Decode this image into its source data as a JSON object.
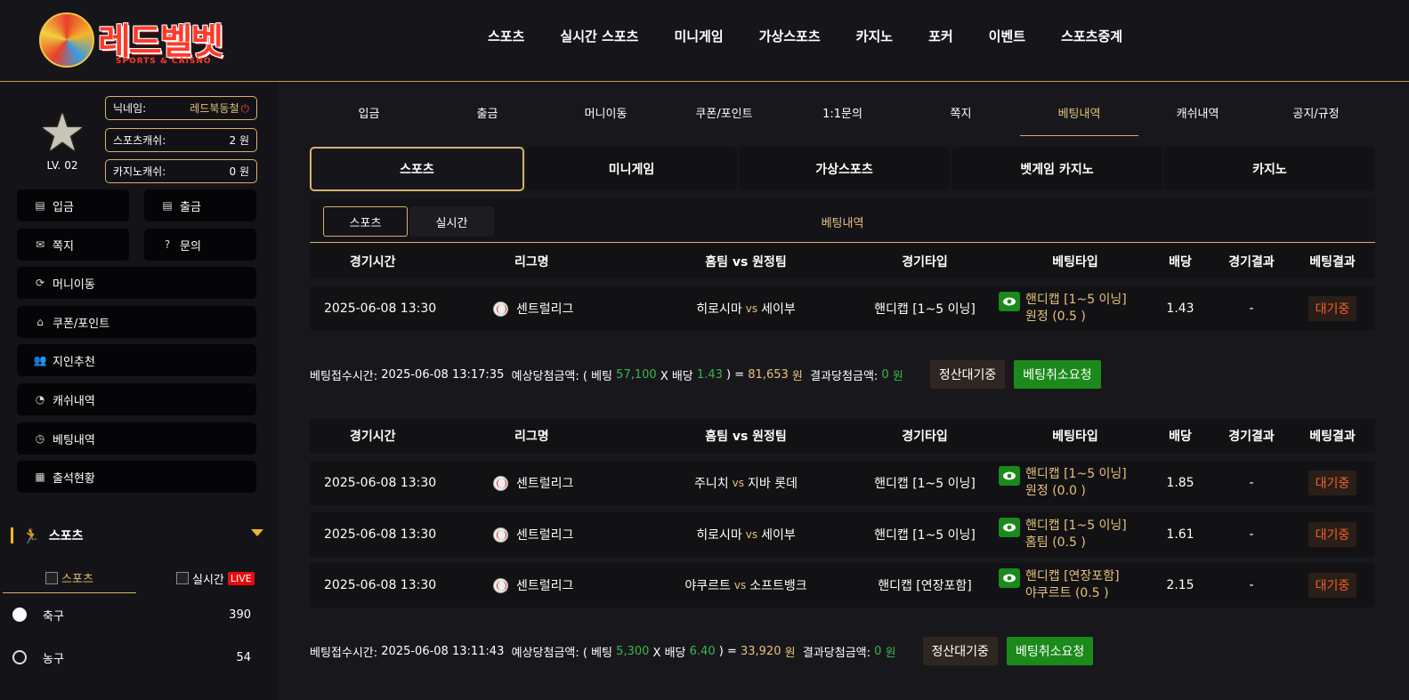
{
  "header": {
    "logo_text": "레드벨벳",
    "logo_sub": "SPORTS & CAISNO",
    "nav": [
      "스포츠",
      "실시간 스포츠",
      "미니게임",
      "가상스포츠",
      "카지노",
      "포커",
      "이벤트",
      "스포츠중계"
    ]
  },
  "profile": {
    "level": "LV. 02",
    "nickname_label": "닉네임:",
    "nickname": "레드북동철",
    "sports_cash_label": "스포츠캐쉬:",
    "sports_cash": "2 원",
    "casino_cash_label": "카지노캐쉬:",
    "casino_cash": "0 원"
  },
  "sidebar": {
    "buttons": [
      "입금",
      "출금",
      "쪽지",
      "문의",
      "머니이동",
      "쿠폰/포인트",
      "지인추천",
      "캐쉬내역",
      "베팅내역",
      "출석현황"
    ],
    "sports_title": "스포츠",
    "sub_tabs": [
      "스포츠",
      "실시간"
    ],
    "live_badge": "LIVE",
    "sports": [
      {
        "name": "축구",
        "count": "390"
      },
      {
        "name": "농구",
        "count": "54"
      }
    ]
  },
  "main": {
    "tabs": [
      "입금",
      "출금",
      "머니이동",
      "쿠폰/포인트",
      "1:1문의",
      "쪽지",
      "베팅내역",
      "캐쉬내역",
      "공지/규정"
    ],
    "active_tab": "베팅내역",
    "game_tabs": [
      "스포츠",
      "미니게임",
      "가상스포츠",
      "벳게임 카지노",
      "카지노"
    ],
    "sub_tabs": [
      "스포츠",
      "실시간"
    ],
    "sub_title": "베팅내역",
    "columns": [
      "경기시간",
      "리그명",
      "홈팀 vs 원정팀",
      "경기타입",
      "베팅타입",
      "배당",
      "경기결과",
      "베팅결과"
    ],
    "vs": "vs",
    "slips": [
      {
        "rows": [
          {
            "time": "2025-06-08 13:30",
            "league": "센트럴리그",
            "home": "히로시마",
            "away": "세이부",
            "type": "핸디캡 [1~5 이닝]",
            "bet1": "핸디캡 [1~5 이닝]",
            "bet2": "원정 (0.5 )",
            "odds": "1.43",
            "result": "-",
            "bet_result": "대기중"
          }
        ],
        "summary": {
          "time_label": "베팅접수시간:",
          "time": "2025-06-08 13:17:35",
          "expected_label": "예상당첨금액: ( 베팅",
          "stake": "57,100",
          "x_label": "X 배당",
          "odds": "1.43",
          "eq": ") =",
          "expected": "81,653",
          "won": "원",
          "result_label": "결과당첨금액:",
          "result": "0",
          "result_won": "원",
          "settle": "정산대기중",
          "cancel": "베팅취소요청"
        }
      },
      {
        "rows": [
          {
            "time": "2025-06-08 13:30",
            "league": "센트럴리그",
            "home": "주니치",
            "away": "지바 롯데",
            "type": "핸디캡 [1~5 이닝]",
            "bet1": "핸디캡 [1~5 이닝]",
            "bet2": "원정 (0.0 )",
            "odds": "1.85",
            "result": "-",
            "bet_result": "대기중"
          },
          {
            "time": "2025-06-08 13:30",
            "league": "센트럴리그",
            "home": "히로시마",
            "away": "세이부",
            "type": "핸디캡 [1~5 이닝]",
            "bet1": "핸디캡 [1~5 이닝]",
            "bet2": "홈팀 (0.5 )",
            "odds": "1.61",
            "result": "-",
            "bet_result": "대기중"
          },
          {
            "time": "2025-06-08 13:30",
            "league": "센트럴리그",
            "home": "야쿠르트",
            "away": "소프트뱅크",
            "type": "핸디캡 [연장포함]",
            "bet1": "핸디캡 [연장포함]",
            "bet2": "야쿠르트 (0.5 )",
            "odds": "2.15",
            "result": "-",
            "bet_result": "대기중"
          }
        ],
        "summary": {
          "time_label": "베팅접수시간:",
          "time": "2025-06-08 13:11:43",
          "expected_label": "예상당첨금액: ( 베팅",
          "stake": "5,300",
          "x_label": "X 배당",
          "odds": "6.40",
          "eq": ") =",
          "expected": "33,920",
          "won": "원",
          "result_label": "결과당첨금액:",
          "result": "0",
          "result_won": "원",
          "settle": "정산대기중",
          "cancel": "베팅취소요청"
        }
      }
    ]
  },
  "colors": {
    "accent_gold": "#e5c27a",
    "border_gold": "#d4b26a",
    "green": "#3bb54a",
    "pending_red": "#f0602a"
  }
}
